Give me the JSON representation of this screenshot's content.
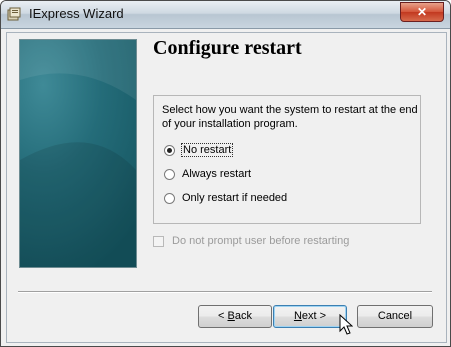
{
  "window": {
    "title": "IExpress Wizard",
    "close_label": "✕"
  },
  "page": {
    "heading": "Configure restart",
    "prompt": "Select how you want the system to restart at the end of your installation program."
  },
  "restart_options": [
    {
      "label": "No restart",
      "checked": true
    },
    {
      "label": "Always restart",
      "checked": false
    },
    {
      "label": "Only restart if needed",
      "checked": false
    }
  ],
  "no_prompt_checkbox": {
    "label": "Do not prompt user before restarting",
    "checked": false,
    "enabled": false
  },
  "buttons": {
    "back_prefix": "< ",
    "back_mnemonic": "B",
    "back_rest": "ack",
    "next_mnemonic": "N",
    "next_rest": "ext >",
    "cancel": "Cancel"
  },
  "icons": {
    "app": "iexpress-app-icon",
    "close": "close-icon",
    "cursor": "mouse-pointer-icon"
  },
  "colors": {
    "side_panel": "#246c79",
    "close_button": "#c2381f",
    "default_button_border": "#3c7fb1"
  }
}
